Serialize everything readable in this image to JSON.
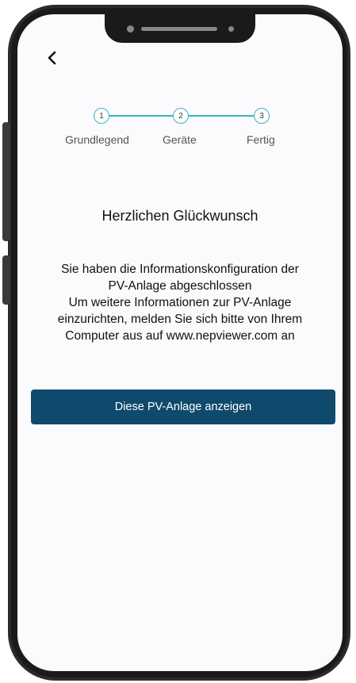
{
  "steps": [
    {
      "number": "1",
      "label": "Grundlegend"
    },
    {
      "number": "2",
      "label": "Geräte"
    },
    {
      "number": "3",
      "label": "Fertig"
    }
  ],
  "title": "Herzlichen Glückwunsch",
  "message_lines": [
    "Sie haben die Informationskonfiguration der",
    "PV-Anlage abgeschlossen",
    "Um weitere Informationen zur PV-Anlage",
    "einzurichten, melden Sie sich bitte von Ihrem",
    "Computer aus auf www.nepviewer.com an"
  ],
  "primary_button": "Diese PV-Anlage anzeigen",
  "icons": {
    "back": "chevron-left-icon"
  },
  "colors": {
    "accent": "#3ab0c4",
    "button_bg": "#0f4a6c",
    "button_text": "#ffffff"
  }
}
